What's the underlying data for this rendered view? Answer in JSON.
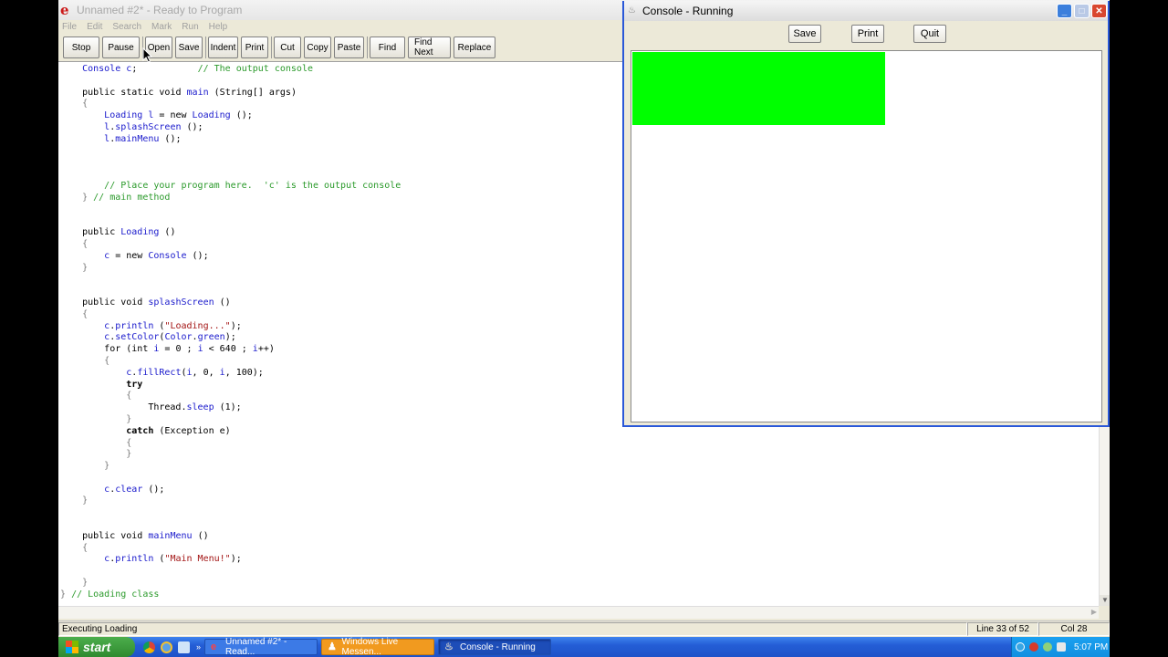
{
  "ide": {
    "title": "Unnamed #2* - Ready to Program",
    "menu": [
      "File",
      "Edit",
      "Search",
      "Mark",
      "Run",
      "Help"
    ],
    "toolbar": {
      "stop": "Stop",
      "pause": "Pause",
      "open": "Open",
      "save": "Save",
      "indent": "Indent",
      "print": "Print",
      "cut": "Cut",
      "copy": "Copy",
      "paste": "Paste",
      "find": "Find",
      "find_next": "Find Next",
      "replace": "Replace"
    },
    "code_lines": [
      "    Console c;           // The output console",
      "",
      "    public static void main (String[] args)",
      "    {",
      "        Loading l = new Loading ();",
      "        l.splashScreen ();",
      "        l.mainMenu ();",
      "",
      "",
      "",
      "        // Place your program here.  'c' is the output console",
      "    } // main method",
      "",
      "",
      "    public Loading ()",
      "    {",
      "        c = new Console ();",
      "    }",
      "",
      "",
      "    public void splashScreen ()",
      "    {",
      "        c.println (\"Loading...\");",
      "        c.setColor(Color.green);",
      "        for (int i = 0 ; i < 640 ; i++)",
      "        {",
      "            c.fillRect(i, 0, i, 100);",
      "            try",
      "            {",
      "                Thread.sleep (1);",
      "            }",
      "            catch (Exception e)",
      "            {",
      "            }",
      "        }",
      "",
      "        c.clear ();",
      "    }",
      "",
      "",
      "    public void mainMenu ()",
      "    {",
      "        c.println (\"Main Menu!\");",
      "",
      "    }",
      "} // Loading class"
    ],
    "status": {
      "message": "Executing Loading",
      "line": "Line 33 of 52",
      "col": "Col 28"
    }
  },
  "console": {
    "title": "Console - Running",
    "buttons": {
      "save": "Save",
      "print": "Print",
      "quit": "Quit"
    },
    "fill_fraction": 0.54,
    "fill_color": "#00ff00"
  },
  "taskbar": {
    "start": "start",
    "tasks": [
      {
        "label": "Unnamed #2* - Read...",
        "icon": "ready-to-program-icon"
      },
      {
        "label": "Windows Live Messen...",
        "icon": "messenger-icon"
      },
      {
        "label": "Console - Running",
        "icon": "java-icon"
      }
    ],
    "clock": "5:07 PM"
  }
}
